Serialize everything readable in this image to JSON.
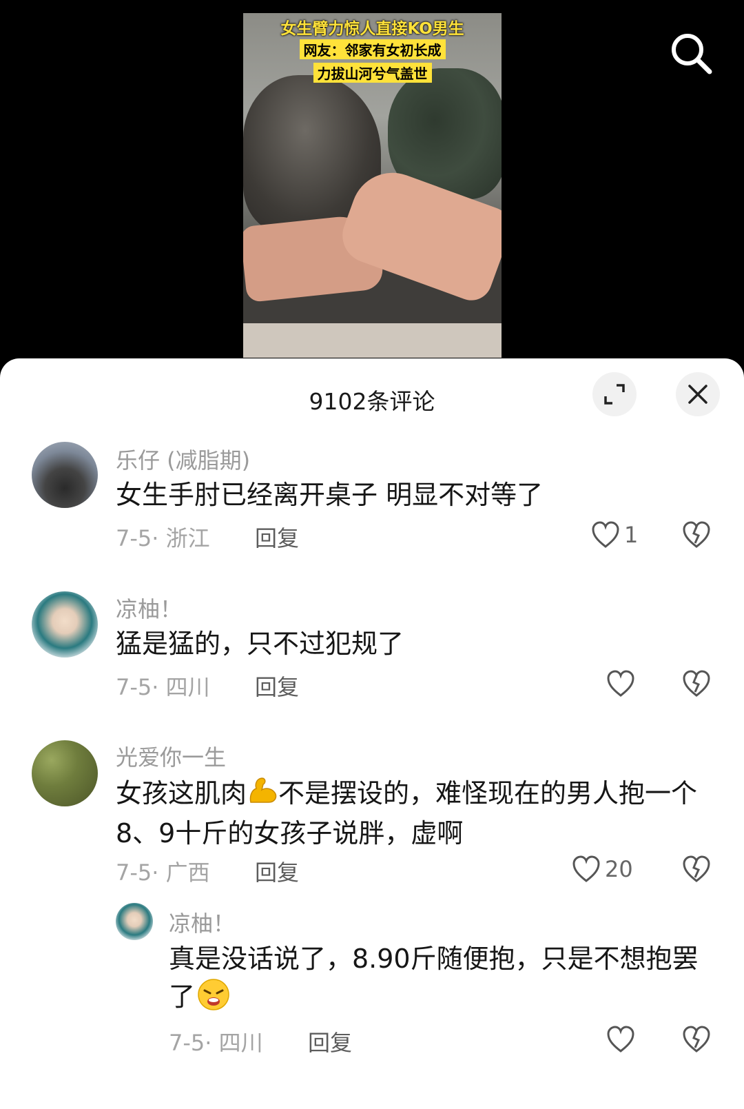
{
  "video": {
    "caption_line1": "女生臂力惊人直接KO男生",
    "caption_line2": "网友：邻家有女初长成",
    "caption_line3": "力拔山河兮气盖世"
  },
  "search": {
    "icon": "search-icon"
  },
  "sheet": {
    "title": "9102条评论",
    "expand_icon": "expand-icon",
    "close_icon": "close-icon"
  },
  "comments": [
    {
      "username": "乐仔 (减脂期)",
      "text": "女生手肘已经离开桌子  明显不对等了",
      "meta": "7-5· 浙江",
      "reply_label": "回复",
      "likes": "1"
    },
    {
      "username": "凉柚！",
      "text": "猛是猛的，只不过犯规了",
      "meta": "7-5· 四川",
      "reply_label": "回复",
      "likes": ""
    },
    {
      "username": "光爱你一生",
      "text_before_emoji": "女孩这肌肉",
      "emoji": "💪",
      "text_after_emoji": "不是摆设的，难怪现在的男人抱一个8、9十斤的女孩子说胖，虚啊",
      "meta": "7-5· 广西",
      "reply_label": "回复",
      "likes": "20"
    }
  ],
  "sub_reply": {
    "username": "凉柚！",
    "text": "真是没话说了，8.90斤随便抱，只是不想抱罢了",
    "emoji": "😩",
    "meta": "7-5· 四川",
    "reply_label": "回复",
    "likes": ""
  },
  "colors": {
    "caption_yellow": "#ffe23a",
    "sheet_bg": "#ffffff",
    "muted_text": "#9a9a9a"
  }
}
